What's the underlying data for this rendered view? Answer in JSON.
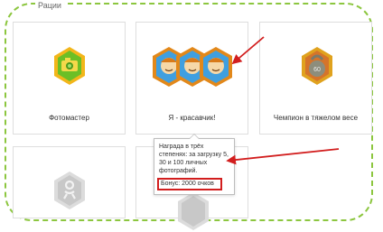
{
  "section": {
    "title": "Рации"
  },
  "cards": [
    {
      "label": "Фотомастер",
      "icon": "camera-badge-icon"
    },
    {
      "label": "Я - красавчик!",
      "icon": "smiling-face-badge-icon"
    },
    {
      "label": "Чемпион в тяжелом весе",
      "icon": "kettlebell-badge-icon"
    },
    {
      "label": "",
      "icon": "odnoklassniki-locked-badge-icon"
    },
    {
      "label": "",
      "icon": "odnoklassniki-locked-badge-icon"
    }
  ],
  "badges": {
    "kettlebell_weight": "60"
  },
  "tooltip": {
    "text": "Награда в трёх степенях: за загрузку 5, 30 и 100 личных фотографий.",
    "bonus": "Бонус: 2000 очков"
  },
  "colors": {
    "frame_border": "#8cc63f",
    "annotation_red": "#d21e1e",
    "badge_gold": "#f2b61a",
    "badge_green": "#6cbf26"
  }
}
